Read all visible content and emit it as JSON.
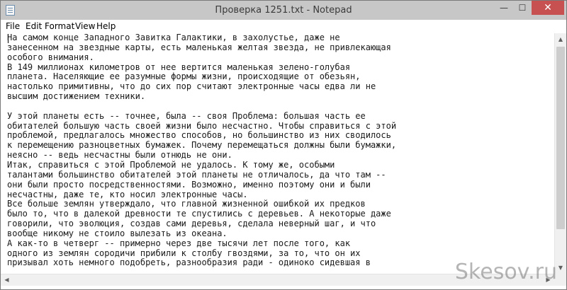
{
  "window": {
    "title": "Проверка 1251.txt - Notepad",
    "controls": {
      "minimize": "—",
      "maximize": "☐",
      "close": "✕"
    }
  },
  "menu": {
    "file": "File",
    "edit": "Edit",
    "format": "Format",
    "view": "View",
    "help": "Help"
  },
  "document": {
    "text": "На самом конце Западного Завитка Галактики, в захолустье, даже не\nзанесенном на звездные карты, есть маленькая желтая звезда, не привлекающая\nособого внимания.\nВ 149 миллионах километров от нее вертится маленькая зелено-голубая\nпланета. Населяющие ее разумные формы жизни, происходящие от обезьян,\nнастолько примитивны, что до сих пор считают электронные часы едва ли не\nвысшим достижением техники.\n\nУ этой планеты есть -- точнее, была -- своя Проблема: большая часть ее\nобитателей большую часть своей жизни было несчастно. Чтобы справиться с этой\nпроблемой, предлагалось множество способов, но большинство из них сводилось\nк перемещению разноцветных бумажек. Почему перемещаться должны были бумажки,\nнеясно -- ведь несчастны были отнюдь не они.\nИтак, справиться с этой Проблемой не удалось. К тому же, особыми\nталантами большинство обитателей этой планеты не отличалось, да что там --\nони были просто посредственностями. Возможно, именно поэтому они и были\nнесчастны, даже те, кто носил электронные часы.\nВсе больше землян утверждало, что главной жизненной ошибкой их предков\nбыло то, что в далекой древности те спустились с деревьев. А некоторые даже\nговорили, что эволюция, создав сами деревья, сделала неверный шаг, и что\nвообще никому не стоило вылезать из океана.\nА как-то в четверг -- примерно через две тысячи лет после того, как\nодного из землян сородичи прибили к столбу гвоздями, за то, что он их\nпризывал хоть немного подобреть, разнообразия ради - одиноко сидевшая в"
  },
  "scrollbars": {
    "up": "▲",
    "down": "▼",
    "left": "◀",
    "right": "▶"
  },
  "watermark": "Skesov.ru"
}
